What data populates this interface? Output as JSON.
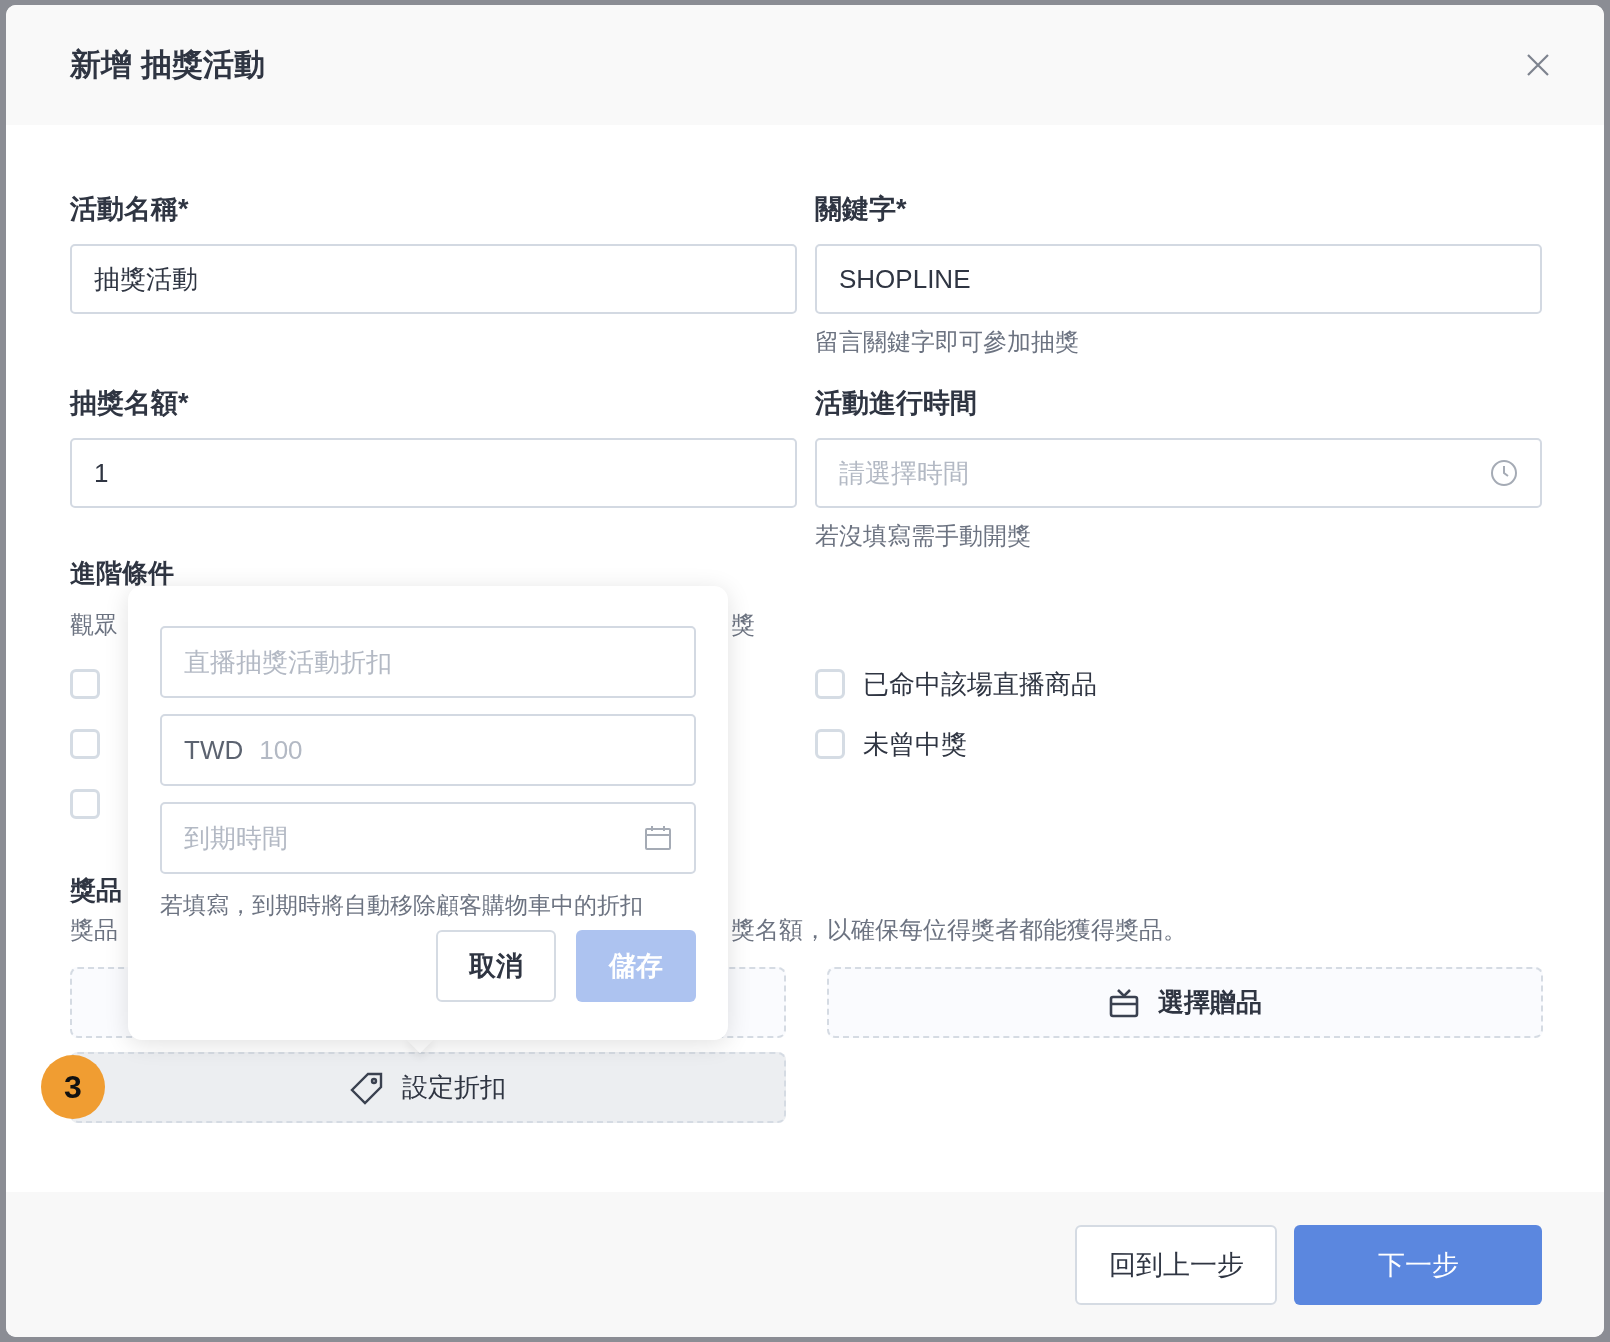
{
  "dialog": {
    "title": "新增 抽獎活動"
  },
  "fields": [
    {
      "kind": "text",
      "label": "活動名稱*",
      "value": "抽獎活動"
    },
    {
      "kind": "text",
      "label": "關鍵字*",
      "value": "SHOPLINE",
      "hint": "留言關鍵字即可參加抽獎"
    },
    {
      "kind": "text",
      "label": "抽獎名額*",
      "value": "1"
    },
    {
      "kind": "time",
      "label": "活動進行時間",
      "placeholder": "請選擇時間",
      "hint": "若沒填寫需手動開獎"
    }
  ],
  "advanced": {
    "title": "進階條件",
    "description_parts": [
      "觀眾",
      "獎"
    ],
    "left_conditions": [
      {
        "checked": false
      },
      {
        "checked": false
      },
      {
        "checked": false
      }
    ],
    "right_conditions": [
      {
        "label": "已命中該場直播商品",
        "checked": false
      },
      {
        "label": "未曾中獎",
        "checked": false
      }
    ]
  },
  "prizes": {
    "title": "獎品",
    "description_parts": [
      "獎品",
      "獎名額，以確保每位得獎者都能獲得獎品。"
    ],
    "gift_button": "選擇贈品",
    "discount_button": "設定折扣",
    "step_badge": "3"
  },
  "popover": {
    "name_placeholder": "直播抽獎活動折扣",
    "currency": "TWD",
    "amount_placeholder": "100",
    "expiry_placeholder": "到期時間",
    "hint": "若填寫，到期時將自動移除顧客購物車中的折扣",
    "buttons": [
      {
        "label": "取消",
        "kind": "secondary",
        "disabled": false
      },
      {
        "label": "儲存",
        "kind": "primary",
        "disabled": true
      }
    ]
  },
  "footer": {
    "buttons": [
      {
        "label": "回到上一步",
        "kind": "secondary"
      },
      {
        "label": "下一步",
        "kind": "primary"
      }
    ]
  }
}
